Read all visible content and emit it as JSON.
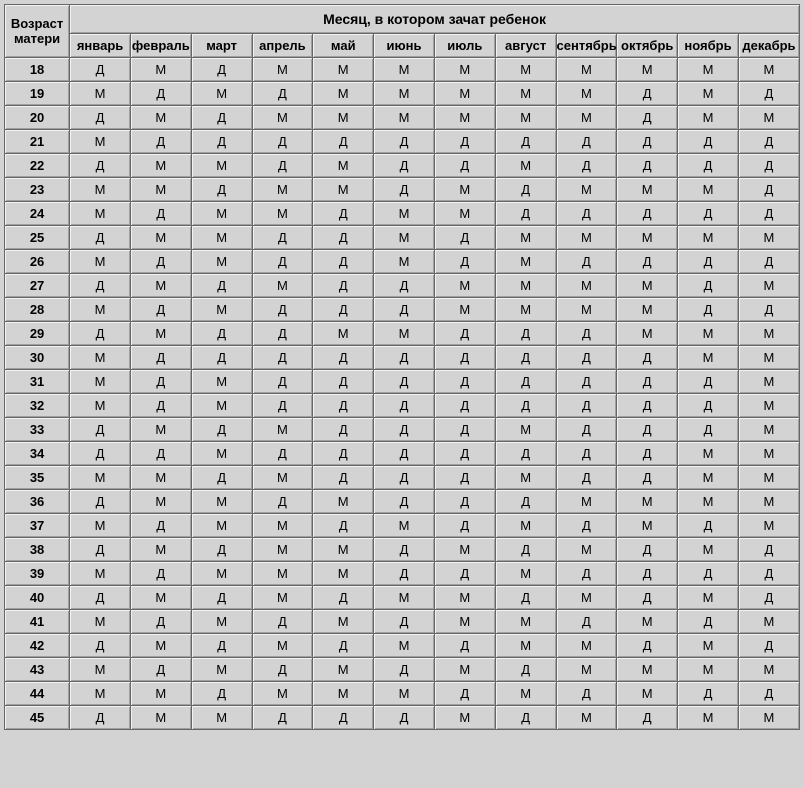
{
  "chart_data": {
    "type": "table",
    "title": "Месяц, в котором зачат ребенок",
    "row_header": "Возраст матери",
    "columns": [
      "январь",
      "февраль",
      "март",
      "апрель",
      "май",
      "июнь",
      "июль",
      "август",
      "сентябрь",
      "октябрь",
      "ноябрь",
      "декабрь"
    ],
    "rows": [
      {
        "age": "18",
        "v": [
          "Д",
          "М",
          "Д",
          "М",
          "М",
          "М",
          "М",
          "М",
          "М",
          "М",
          "М",
          "М"
        ]
      },
      {
        "age": "19",
        "v": [
          "М",
          "Д",
          "М",
          "Д",
          "М",
          "М",
          "М",
          "М",
          "М",
          "Д",
          "М",
          "Д"
        ]
      },
      {
        "age": "20",
        "v": [
          "Д",
          "М",
          "Д",
          "М",
          "М",
          "М",
          "М",
          "М",
          "М",
          "Д",
          "М",
          "М"
        ]
      },
      {
        "age": "21",
        "v": [
          "М",
          "Д",
          "Д",
          "Д",
          "Д",
          "Д",
          "Д",
          "Д",
          "Д",
          "Д",
          "Д",
          "Д"
        ]
      },
      {
        "age": "22",
        "v": [
          "Д",
          "М",
          "М",
          "Д",
          "М",
          "Д",
          "Д",
          "М",
          "Д",
          "Д",
          "Д",
          "Д"
        ]
      },
      {
        "age": "23",
        "v": [
          "М",
          "М",
          "Д",
          "М",
          "М",
          "Д",
          "М",
          "Д",
          "М",
          "М",
          "М",
          "Д"
        ]
      },
      {
        "age": "24",
        "v": [
          "М",
          "Д",
          "М",
          "М",
          "Д",
          "М",
          "М",
          "Д",
          "Д",
          "Д",
          "Д",
          "Д"
        ]
      },
      {
        "age": "25",
        "v": [
          "Д",
          "М",
          "М",
          "Д",
          "Д",
          "М",
          "Д",
          "М",
          "М",
          "М",
          "М",
          "М"
        ]
      },
      {
        "age": "26",
        "v": [
          "М",
          "Д",
          "М",
          "Д",
          "Д",
          "М",
          "Д",
          "М",
          "Д",
          "Д",
          "Д",
          "Д"
        ]
      },
      {
        "age": "27",
        "v": [
          "Д",
          "М",
          "Д",
          "М",
          "Д",
          "Д",
          "М",
          "М",
          "М",
          "М",
          "Д",
          "М"
        ]
      },
      {
        "age": "28",
        "v": [
          "М",
          "Д",
          "М",
          "Д",
          "Д",
          "Д",
          "М",
          "М",
          "М",
          "М",
          "Д",
          "Д"
        ]
      },
      {
        "age": "29",
        "v": [
          "Д",
          "М",
          "Д",
          "Д",
          "М",
          "М",
          "Д",
          "Д",
          "Д",
          "М",
          "М",
          "М"
        ]
      },
      {
        "age": "30",
        "v": [
          "М",
          "Д",
          "Д",
          "Д",
          "Д",
          "Д",
          "Д",
          "Д",
          "Д",
          "Д",
          "М",
          "М"
        ]
      },
      {
        "age": "31",
        "v": [
          "М",
          "Д",
          "М",
          "Д",
          "Д",
          "Д",
          "Д",
          "Д",
          "Д",
          "Д",
          "Д",
          "М"
        ]
      },
      {
        "age": "32",
        "v": [
          "М",
          "Д",
          "М",
          "Д",
          "Д",
          "Д",
          "Д",
          "Д",
          "Д",
          "Д",
          "Д",
          "М"
        ]
      },
      {
        "age": "33",
        "v": [
          "Д",
          "М",
          "Д",
          "М",
          "Д",
          "Д",
          "Д",
          "М",
          "Д",
          "Д",
          "Д",
          "М"
        ]
      },
      {
        "age": "34",
        "v": [
          "Д",
          "Д",
          "М",
          "Д",
          "Д",
          "Д",
          "Д",
          "Д",
          "Д",
          "Д",
          "М",
          "М"
        ]
      },
      {
        "age": "35",
        "v": [
          "М",
          "М",
          "Д",
          "М",
          "Д",
          "Д",
          "Д",
          "М",
          "Д",
          "Д",
          "М",
          "М"
        ]
      },
      {
        "age": "36",
        "v": [
          "Д",
          "М",
          "М",
          "Д",
          "М",
          "Д",
          "Д",
          "Д",
          "М",
          "М",
          "М",
          "М"
        ]
      },
      {
        "age": "37",
        "v": [
          "М",
          "Д",
          "М",
          "М",
          "Д",
          "М",
          "Д",
          "М",
          "Д",
          "М",
          "Д",
          "М"
        ]
      },
      {
        "age": "38",
        "v": [
          "Д",
          "М",
          "Д",
          "М",
          "М",
          "Д",
          "М",
          "Д",
          "М",
          "Д",
          "М",
          "Д"
        ]
      },
      {
        "age": "39",
        "v": [
          "М",
          "Д",
          "М",
          "М",
          "М",
          "Д",
          "Д",
          "М",
          "Д",
          "Д",
          "Д",
          "Д"
        ]
      },
      {
        "age": "40",
        "v": [
          "Д",
          "М",
          "Д",
          "М",
          "Д",
          "М",
          "М",
          "Д",
          "М",
          "Д",
          "М",
          "Д"
        ]
      },
      {
        "age": "41",
        "v": [
          "М",
          "Д",
          "М",
          "Д",
          "М",
          "Д",
          "М",
          "М",
          "Д",
          "М",
          "Д",
          "М"
        ]
      },
      {
        "age": "42",
        "v": [
          "Д",
          "М",
          "Д",
          "М",
          "Д",
          "М",
          "Д",
          "М",
          "М",
          "Д",
          "М",
          "Д"
        ]
      },
      {
        "age": "43",
        "v": [
          "М",
          "Д",
          "М",
          "Д",
          "М",
          "Д",
          "М",
          "Д",
          "М",
          "М",
          "М",
          "М"
        ]
      },
      {
        "age": "44",
        "v": [
          "М",
          "М",
          "Д",
          "М",
          "М",
          "М",
          "Д",
          "М",
          "Д",
          "М",
          "Д",
          "Д"
        ]
      },
      {
        "age": "45",
        "v": [
          "Д",
          "М",
          "М",
          "Д",
          "Д",
          "Д",
          "М",
          "Д",
          "М",
          "Д",
          "М",
          "М"
        ]
      }
    ]
  }
}
